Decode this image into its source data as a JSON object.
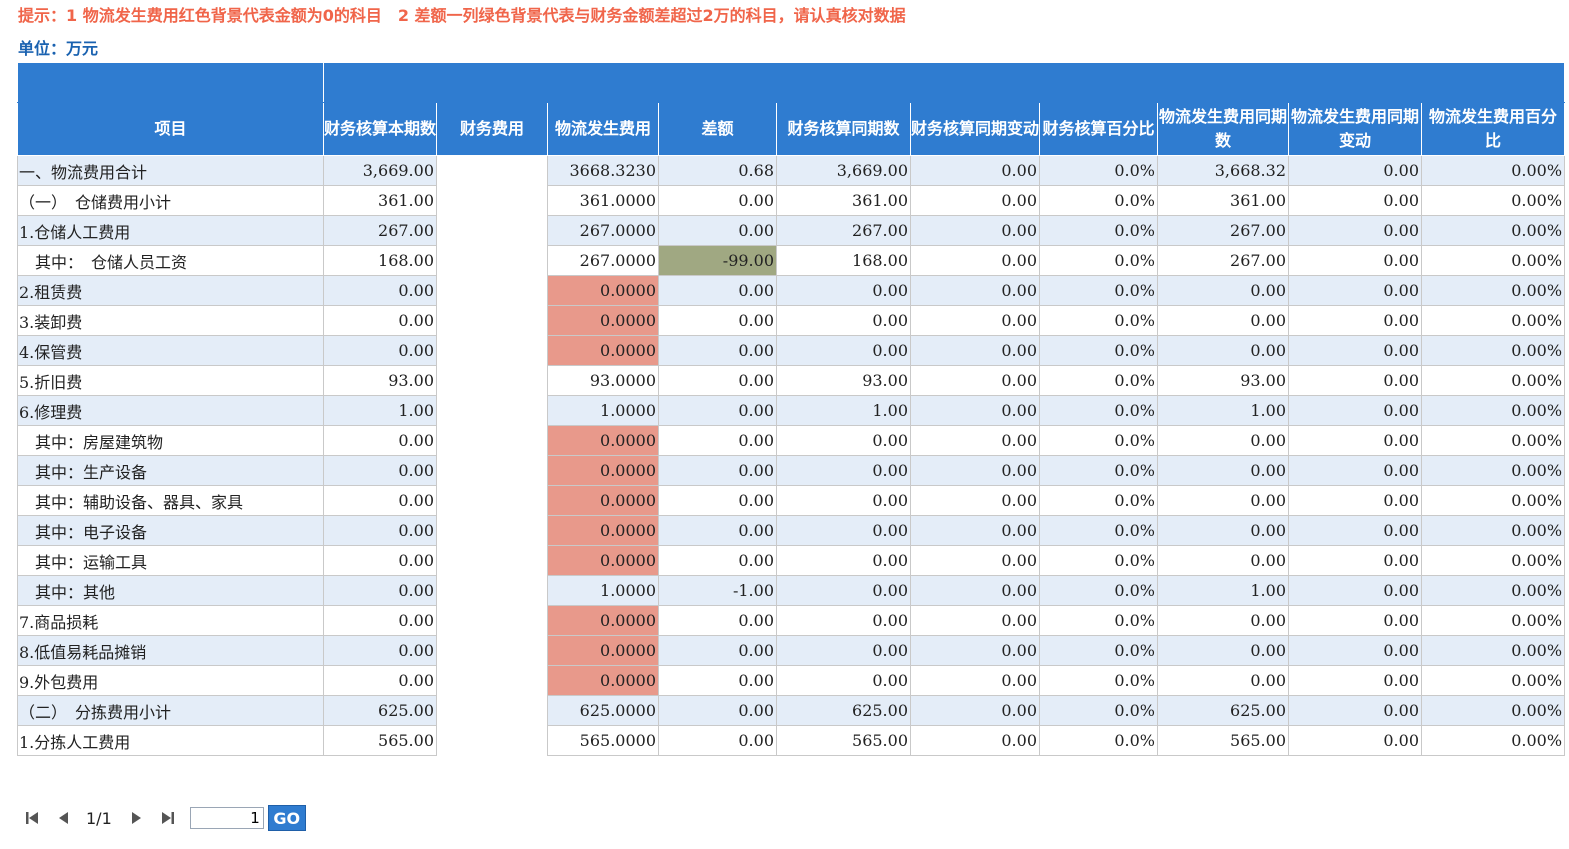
{
  "hint": "提示：1 物流发生费用红色背景代表金额为0的科目　2 差额一列绿色背景代表与财务金额差超过2万的科目，请认真核对数据",
  "unit": "单位：万元",
  "colors": {
    "header_bg": "#2f7cd0",
    "odd_row_bg": "#e4edf8",
    "zero_highlight": "#e8998b",
    "diff_highlight": "#a0a882",
    "hint_text": "#f0654a",
    "unit_text": "#1a62b0"
  },
  "headers": [
    "项目",
    "财务核算本期数",
    "财务费用",
    "物流发生费用",
    "差额",
    "财务核算同期数",
    "财务核算同期变动",
    "财务核算百分比",
    "物流发生费用同期数",
    "物流发生费用同期变动",
    "物流发生费用百分比"
  ],
  "rows": [
    [
      "一、物流费用合计",
      "3,669.00",
      "",
      "3668.3230",
      "0.68",
      "3,669.00",
      "0.00",
      "0.0%",
      "3,668.32",
      "0.00",
      "0.00%"
    ],
    [
      "（一）　仓储费用小计",
      "361.00",
      "",
      "361.0000",
      "0.00",
      "361.00",
      "0.00",
      "0.0%",
      "361.00",
      "0.00",
      "0.00%"
    ],
    [
      "1.仓储人工费用",
      "267.00",
      "",
      "267.0000",
      "0.00",
      "267.00",
      "0.00",
      "0.0%",
      "267.00",
      "0.00",
      "0.00%"
    ],
    [
      "　其中：　仓储人员工资",
      "168.00",
      "",
      "267.0000",
      "-99.00",
      "168.00",
      "0.00",
      "0.0%",
      "267.00",
      "0.00",
      "0.00%"
    ],
    [
      "2.租赁费",
      "0.00",
      "",
      "0.0000",
      "0.00",
      "0.00",
      "0.00",
      "0.0%",
      "0.00",
      "0.00",
      "0.00%"
    ],
    [
      "3.装卸费",
      "0.00",
      "",
      "0.0000",
      "0.00",
      "0.00",
      "0.00",
      "0.0%",
      "0.00",
      "0.00",
      "0.00%"
    ],
    [
      "4.保管费",
      "0.00",
      "",
      "0.0000",
      "0.00",
      "0.00",
      "0.00",
      "0.0%",
      "0.00",
      "0.00",
      "0.00%"
    ],
    [
      "5.折旧费",
      "93.00",
      "",
      "93.0000",
      "0.00",
      "93.00",
      "0.00",
      "0.0%",
      "93.00",
      "0.00",
      "0.00%"
    ],
    [
      "6.修理费",
      "1.00",
      "",
      "1.0000",
      "0.00",
      "1.00",
      "0.00",
      "0.0%",
      "1.00",
      "0.00",
      "0.00%"
    ],
    [
      "　其中：房屋建筑物",
      "0.00",
      "",
      "0.0000",
      "0.00",
      "0.00",
      "0.00",
      "0.0%",
      "0.00",
      "0.00",
      "0.00%"
    ],
    [
      "　其中：生产设备",
      "0.00",
      "",
      "0.0000",
      "0.00",
      "0.00",
      "0.00",
      "0.0%",
      "0.00",
      "0.00",
      "0.00%"
    ],
    [
      "　其中：辅助设备、器具、家具",
      "0.00",
      "",
      "0.0000",
      "0.00",
      "0.00",
      "0.00",
      "0.0%",
      "0.00",
      "0.00",
      "0.00%"
    ],
    [
      "　其中：电子设备",
      "0.00",
      "",
      "0.0000",
      "0.00",
      "0.00",
      "0.00",
      "0.0%",
      "0.00",
      "0.00",
      "0.00%"
    ],
    [
      "　其中：运输工具",
      "0.00",
      "",
      "0.0000",
      "0.00",
      "0.00",
      "0.00",
      "0.0%",
      "0.00",
      "0.00",
      "0.00%"
    ],
    [
      "　其中：其他",
      "0.00",
      "",
      "1.0000",
      "-1.00",
      "0.00",
      "0.00",
      "0.0%",
      "1.00",
      "0.00",
      "0.00%"
    ],
    [
      "7.商品损耗",
      "0.00",
      "",
      "0.0000",
      "0.00",
      "0.00",
      "0.00",
      "0.0%",
      "0.00",
      "0.00",
      "0.00%"
    ],
    [
      "8.低值易耗品摊销",
      "0.00",
      "",
      "0.0000",
      "0.00",
      "0.00",
      "0.00",
      "0.0%",
      "0.00",
      "0.00",
      "0.00%"
    ],
    [
      "9.外包费用",
      "0.00",
      "",
      "0.0000",
      "0.00",
      "0.00",
      "0.00",
      "0.0%",
      "0.00",
      "0.00",
      "0.00%"
    ],
    [
      "（二）　分拣费用小计",
      "625.00",
      "",
      "625.0000",
      "0.00",
      "625.00",
      "0.00",
      "0.0%",
      "625.00",
      "0.00",
      "0.00%"
    ],
    [
      "1.分拣人工费用",
      "565.00",
      "",
      "565.0000",
      "0.00",
      "565.00",
      "0.00",
      "0.0%",
      "565.00",
      "0.00",
      "0.00%"
    ]
  ],
  "highlights": {
    "zero_cells": [
      [
        4,
        3
      ],
      [
        5,
        3
      ],
      [
        6,
        3
      ],
      [
        9,
        3
      ],
      [
        10,
        3
      ],
      [
        11,
        3
      ],
      [
        12,
        3
      ],
      [
        13,
        3
      ],
      [
        15,
        3
      ],
      [
        16,
        3
      ],
      [
        17,
        3
      ]
    ],
    "diff_cells": [
      [
        3,
        4
      ]
    ]
  },
  "pager": {
    "first_icon": "first-page-icon",
    "prev_icon": "prev-page-icon",
    "next_icon": "next-page-icon",
    "last_icon": "last-page-icon",
    "page_info": "1/1",
    "page_input": "1",
    "go_label": "GO"
  }
}
